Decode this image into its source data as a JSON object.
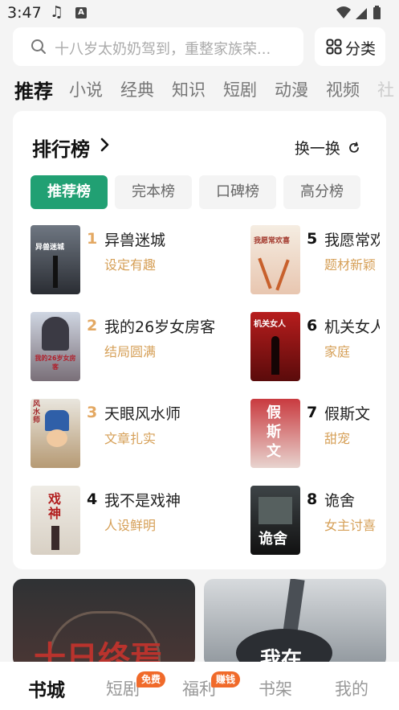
{
  "status_bar": {
    "time": "3:47",
    "icons": [
      "music-note-icon",
      "a-icon",
      "wifi-icon",
      "signal-icon",
      "battery-icon"
    ]
  },
  "search": {
    "placeholder": "十八岁太奶奶驾到，重整家族荣..."
  },
  "category_button": {
    "label": "分类",
    "icon": "grid-icon"
  },
  "top_tabs": [
    "推荐",
    "小说",
    "经典",
    "知识",
    "短剧",
    "动漫",
    "视频",
    "社"
  ],
  "ranking": {
    "title": "排行榜",
    "refresh_label": "换一换",
    "chips": [
      "推荐榜",
      "完本榜",
      "口碑榜",
      "高分榜"
    ],
    "items": [
      {
        "rank": "1",
        "title": "异兽迷城",
        "tag": "设定有趣",
        "cover_text": "异兽迷城"
      },
      {
        "rank": "2",
        "title": "我的26岁女房客",
        "tag": "结局圆满",
        "cover_text": "我的26岁女房客"
      },
      {
        "rank": "3",
        "title": "天眼风水师",
        "tag": "文章扎实",
        "cover_text": "风水师"
      },
      {
        "rank": "4",
        "title": "我不是戏神",
        "tag": "人设鲜明",
        "cover_text": "戏神"
      },
      {
        "rank": "5",
        "title": "我愿常欢喜",
        "tag": "题材新颖",
        "cover_text": "我愿常欢喜"
      },
      {
        "rank": "6",
        "title": "机关女人",
        "tag": "家庭",
        "cover_text": "机关女人"
      },
      {
        "rank": "7",
        "title": "假斯文",
        "tag": "甜宠",
        "cover_text": "假斯文"
      },
      {
        "rank": "8",
        "title": "诡舍",
        "tag": "女主讨喜",
        "cover_text": "诡舍"
      }
    ]
  },
  "banners": [
    {
      "cover_text": "十日终焉"
    },
    {
      "cover_text": "我在"
    }
  ],
  "bottom_nav": [
    {
      "label": "书城",
      "badge": ""
    },
    {
      "label": "短剧",
      "badge": "免费"
    },
    {
      "label": "福利",
      "badge": "赚钱"
    },
    {
      "label": "书架",
      "badge": ""
    },
    {
      "label": "我的",
      "badge": ""
    }
  ],
  "colors": {
    "accent": "#21a073",
    "tag": "#d6a058",
    "badge": "#f06a2a",
    "top_three_rank": "#e3a862"
  }
}
